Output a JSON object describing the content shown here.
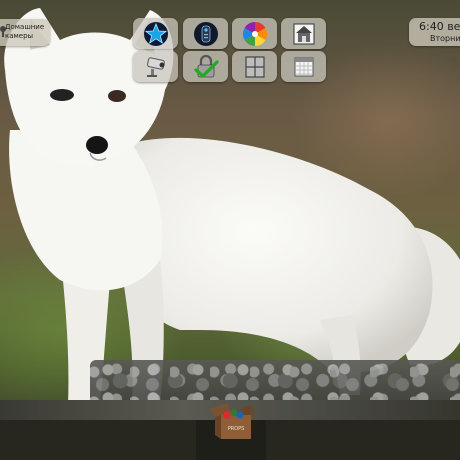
{
  "wallpaper": {
    "subject": "arctic fox"
  },
  "widgets": {
    "cameras": {
      "line1": "Домашние",
      "line2": "камеры",
      "icon": "camera-icon"
    },
    "clock": {
      "time": "6:40 веч",
      "day": "Вторни"
    }
  },
  "tiles": [
    {
      "name": "favorites",
      "icon": "star-icon"
    },
    {
      "name": "remote",
      "icon": "remote-control-icon"
    },
    {
      "name": "colors",
      "icon": "color-wheel-icon"
    },
    {
      "name": "home-settings",
      "icon": "house-icon"
    },
    {
      "name": "security-camera",
      "icon": "security-camera-icon"
    },
    {
      "name": "lock",
      "icon": "lock-check-icon"
    },
    {
      "name": "window",
      "icon": "window-icon"
    },
    {
      "name": "calendar",
      "icon": "calendar-icon"
    }
  ],
  "dock": {
    "props_label": "PROPS"
  },
  "colors": {
    "tile_bg": "#c8c6bc",
    "star": "#1aa3e8",
    "check": "#22aa22"
  }
}
